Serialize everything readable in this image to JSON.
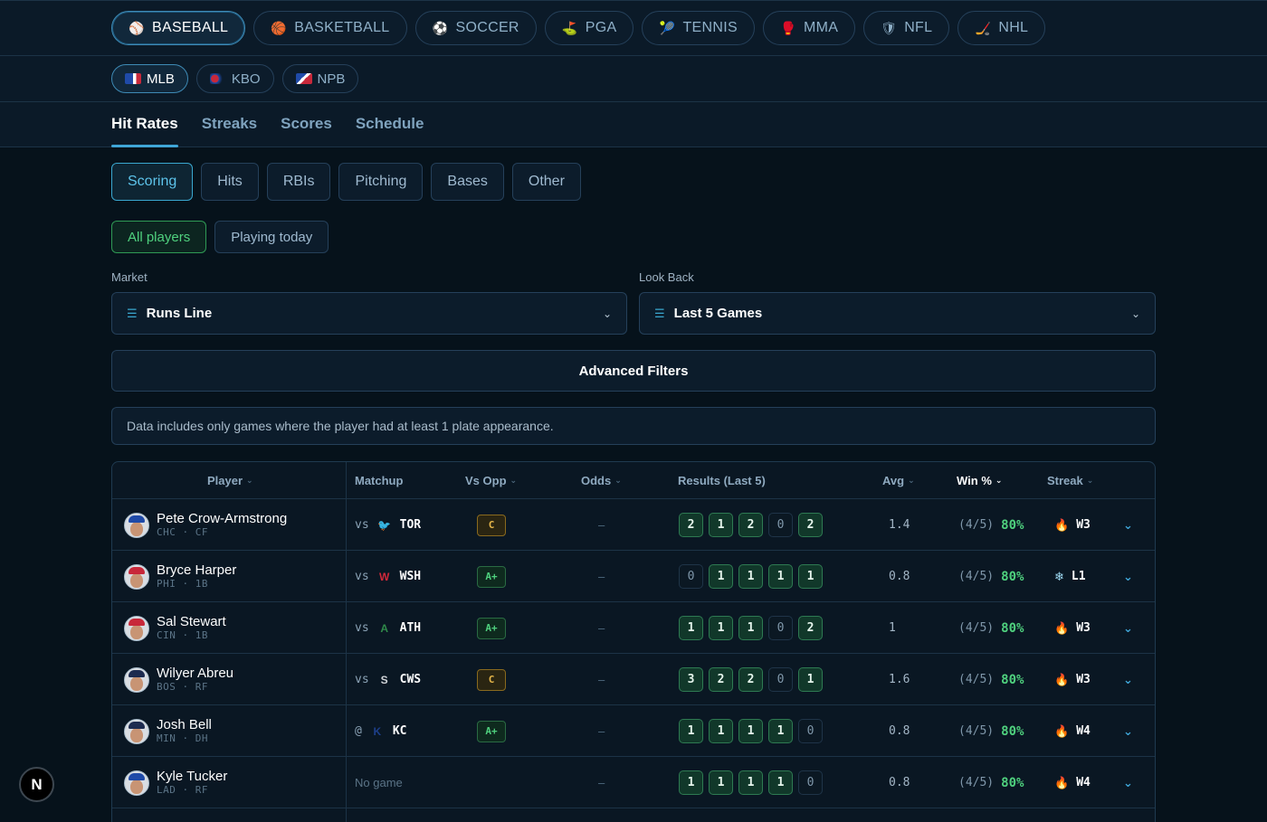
{
  "sports": [
    {
      "label": "BASEBALL",
      "icon": "baseball-icon",
      "glyph": "⚾",
      "active": true
    },
    {
      "label": "BASKETBALL",
      "icon": "basketball-icon",
      "glyph": "🏀",
      "active": false
    },
    {
      "label": "SOCCER",
      "icon": "soccer-ball-icon",
      "glyph": "⚽",
      "active": false
    },
    {
      "label": "PGA",
      "icon": "pga-logo-icon",
      "glyph": "⛳",
      "active": false
    },
    {
      "label": "TENNIS",
      "icon": "tennis-racket-icon",
      "glyph": "🎾",
      "active": false
    },
    {
      "label": "MMA",
      "icon": "mma-glove-icon",
      "glyph": "🥊",
      "active": false
    },
    {
      "label": "NFL",
      "icon": "nfl-shield-icon",
      "glyph": "🛡",
      "active": false
    },
    {
      "label": "NHL",
      "icon": "nhl-shield-icon",
      "glyph": "🏒",
      "active": false
    }
  ],
  "leagues": [
    {
      "label": "MLB",
      "icon": "mlb-logo-icon",
      "active": true
    },
    {
      "label": "KBO",
      "icon": "kbo-logo-icon",
      "active": false
    },
    {
      "label": "NPB",
      "icon": "npb-logo-icon",
      "active": false
    }
  ],
  "tabs": [
    {
      "label": "Hit Rates",
      "active": true
    },
    {
      "label": "Streaks",
      "active": false
    },
    {
      "label": "Scores",
      "active": false
    },
    {
      "label": "Schedule",
      "active": false
    }
  ],
  "categories": [
    {
      "label": "Scoring",
      "active": true
    },
    {
      "label": "Hits",
      "active": false
    },
    {
      "label": "RBIs",
      "active": false
    },
    {
      "label": "Pitching",
      "active": false
    },
    {
      "label": "Bases",
      "active": false
    },
    {
      "label": "Other",
      "active": false
    }
  ],
  "player_filters": [
    {
      "label": "All players",
      "active": true
    },
    {
      "label": "Playing today",
      "active": false
    }
  ],
  "market": {
    "label": "Market",
    "value": "Runs Line"
  },
  "lookback": {
    "label": "Look Back",
    "value": "Last 5 Games"
  },
  "advanced_filters_label": "Advanced Filters",
  "note": "Data includes only games where the player had at least 1 plate appearance.",
  "table": {
    "headers": {
      "player": "Player",
      "matchup": "Matchup",
      "vs_opp": "Vs Opp",
      "odds": "Odds",
      "results": "Results (Last 5)",
      "avg": "Avg",
      "win": "Win %",
      "streak": "Streak"
    },
    "rows": [
      {
        "name": "Pete Crow-Armstrong",
        "meta": "CHC · CF",
        "cap_color": "#1f4aa8",
        "vs": "vs",
        "team_logo": "blue-jays-logo-icon",
        "team": "TOR",
        "grade": "C",
        "odds": "–",
        "results": [
          2,
          1,
          2,
          0,
          2
        ],
        "avg": "1.4",
        "win_frac": "(4/5)",
        "win_pct": "80%",
        "streak_icon": "fire-icon",
        "streak": "W3"
      },
      {
        "name": "Bryce Harper",
        "meta": "PHI · 1B",
        "cap_color": "#c8283a",
        "vs": "vs",
        "team_logo": "nationals-logo-icon",
        "team": "WSH",
        "grade": "A+",
        "odds": "–",
        "results": [
          0,
          1,
          1,
          1,
          1
        ],
        "avg": "0.8",
        "win_frac": "(4/5)",
        "win_pct": "80%",
        "streak_icon": "snowflake-icon",
        "streak": "L1"
      },
      {
        "name": "Sal Stewart",
        "meta": "CIN · 1B",
        "cap_color": "#c8283a",
        "vs": "vs",
        "team_logo": "athletics-logo-icon",
        "team": "ATH",
        "grade": "A+",
        "odds": "–",
        "results": [
          1,
          1,
          1,
          0,
          2
        ],
        "avg": "1",
        "win_frac": "(4/5)",
        "win_pct": "80%",
        "streak_icon": "fire-icon",
        "streak": "W3"
      },
      {
        "name": "Wilyer Abreu",
        "meta": "BOS · RF",
        "cap_color": "#1d2b4f",
        "vs": "vs",
        "team_logo": "white-sox-logo-icon",
        "team": "CWS",
        "grade": "C",
        "odds": "–",
        "results": [
          3,
          2,
          2,
          0,
          1
        ],
        "avg": "1.6",
        "win_frac": "(4/5)",
        "win_pct": "80%",
        "streak_icon": "fire-icon",
        "streak": "W3"
      },
      {
        "name": "Josh Bell",
        "meta": "MIN · DH",
        "cap_color": "#1d2b4f",
        "vs": "@",
        "team_logo": "royals-logo-icon",
        "team": "KC",
        "grade": "A+",
        "odds": "–",
        "results": [
          1,
          1,
          1,
          1,
          0
        ],
        "avg": "0.8",
        "win_frac": "(4/5)",
        "win_pct": "80%",
        "streak_icon": "fire-icon",
        "streak": "W4"
      },
      {
        "name": "Kyle Tucker",
        "meta": "LAD · RF",
        "cap_color": "#1f4aa8",
        "vs": "",
        "team_logo": "",
        "team": "",
        "no_game": "No game",
        "grade": "",
        "odds": "–",
        "results": [
          1,
          1,
          1,
          1,
          0
        ],
        "avg": "0.8",
        "win_frac": "(4/5)",
        "win_pct": "80%",
        "streak_icon": "fire-icon",
        "streak": "W4"
      }
    ]
  },
  "corner_badge": "N"
}
